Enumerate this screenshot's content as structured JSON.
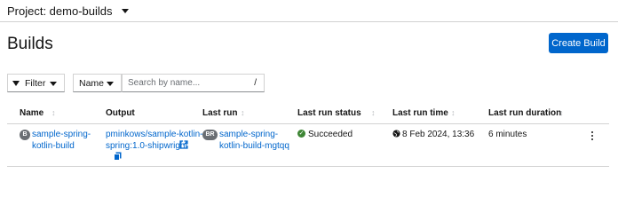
{
  "project": {
    "label": "Project: demo-builds"
  },
  "page": {
    "title": "Builds",
    "create_button": "Create Build"
  },
  "toolbar": {
    "filter_label": "Filter",
    "filter_by": "Name",
    "search_placeholder": "Search by name...",
    "search_shortcut": "/"
  },
  "table": {
    "columns": [
      "Name",
      "Output",
      "Last run",
      "Last run status",
      "Last run time",
      "Last run duration"
    ],
    "rows": [
      {
        "name_badge": "B",
        "name_line1": "sample-spring-",
        "name_line2": "kotlin-build",
        "output_line1": "pminkows/sample-kotlin-",
        "output_line2": "spring:1.0-shipwright",
        "last_run_badge": "BR",
        "last_run_line1": "sample-spring-",
        "last_run_line2": "kotlin-build-mgtqq",
        "status": "Succeeded",
        "time": "8 Feb 2024, 13:36",
        "duration": "6 minutes"
      }
    ]
  },
  "colors": {
    "primary": "#0066cc",
    "success": "#3e8635",
    "badge": "#6a6e73"
  },
  "icons": {
    "filter": "filter-icon",
    "external_link": "external-link-icon",
    "copy": "copy-icon",
    "status": "check-circle-icon",
    "time": "globe-icon",
    "actions": "kebab-icon"
  }
}
